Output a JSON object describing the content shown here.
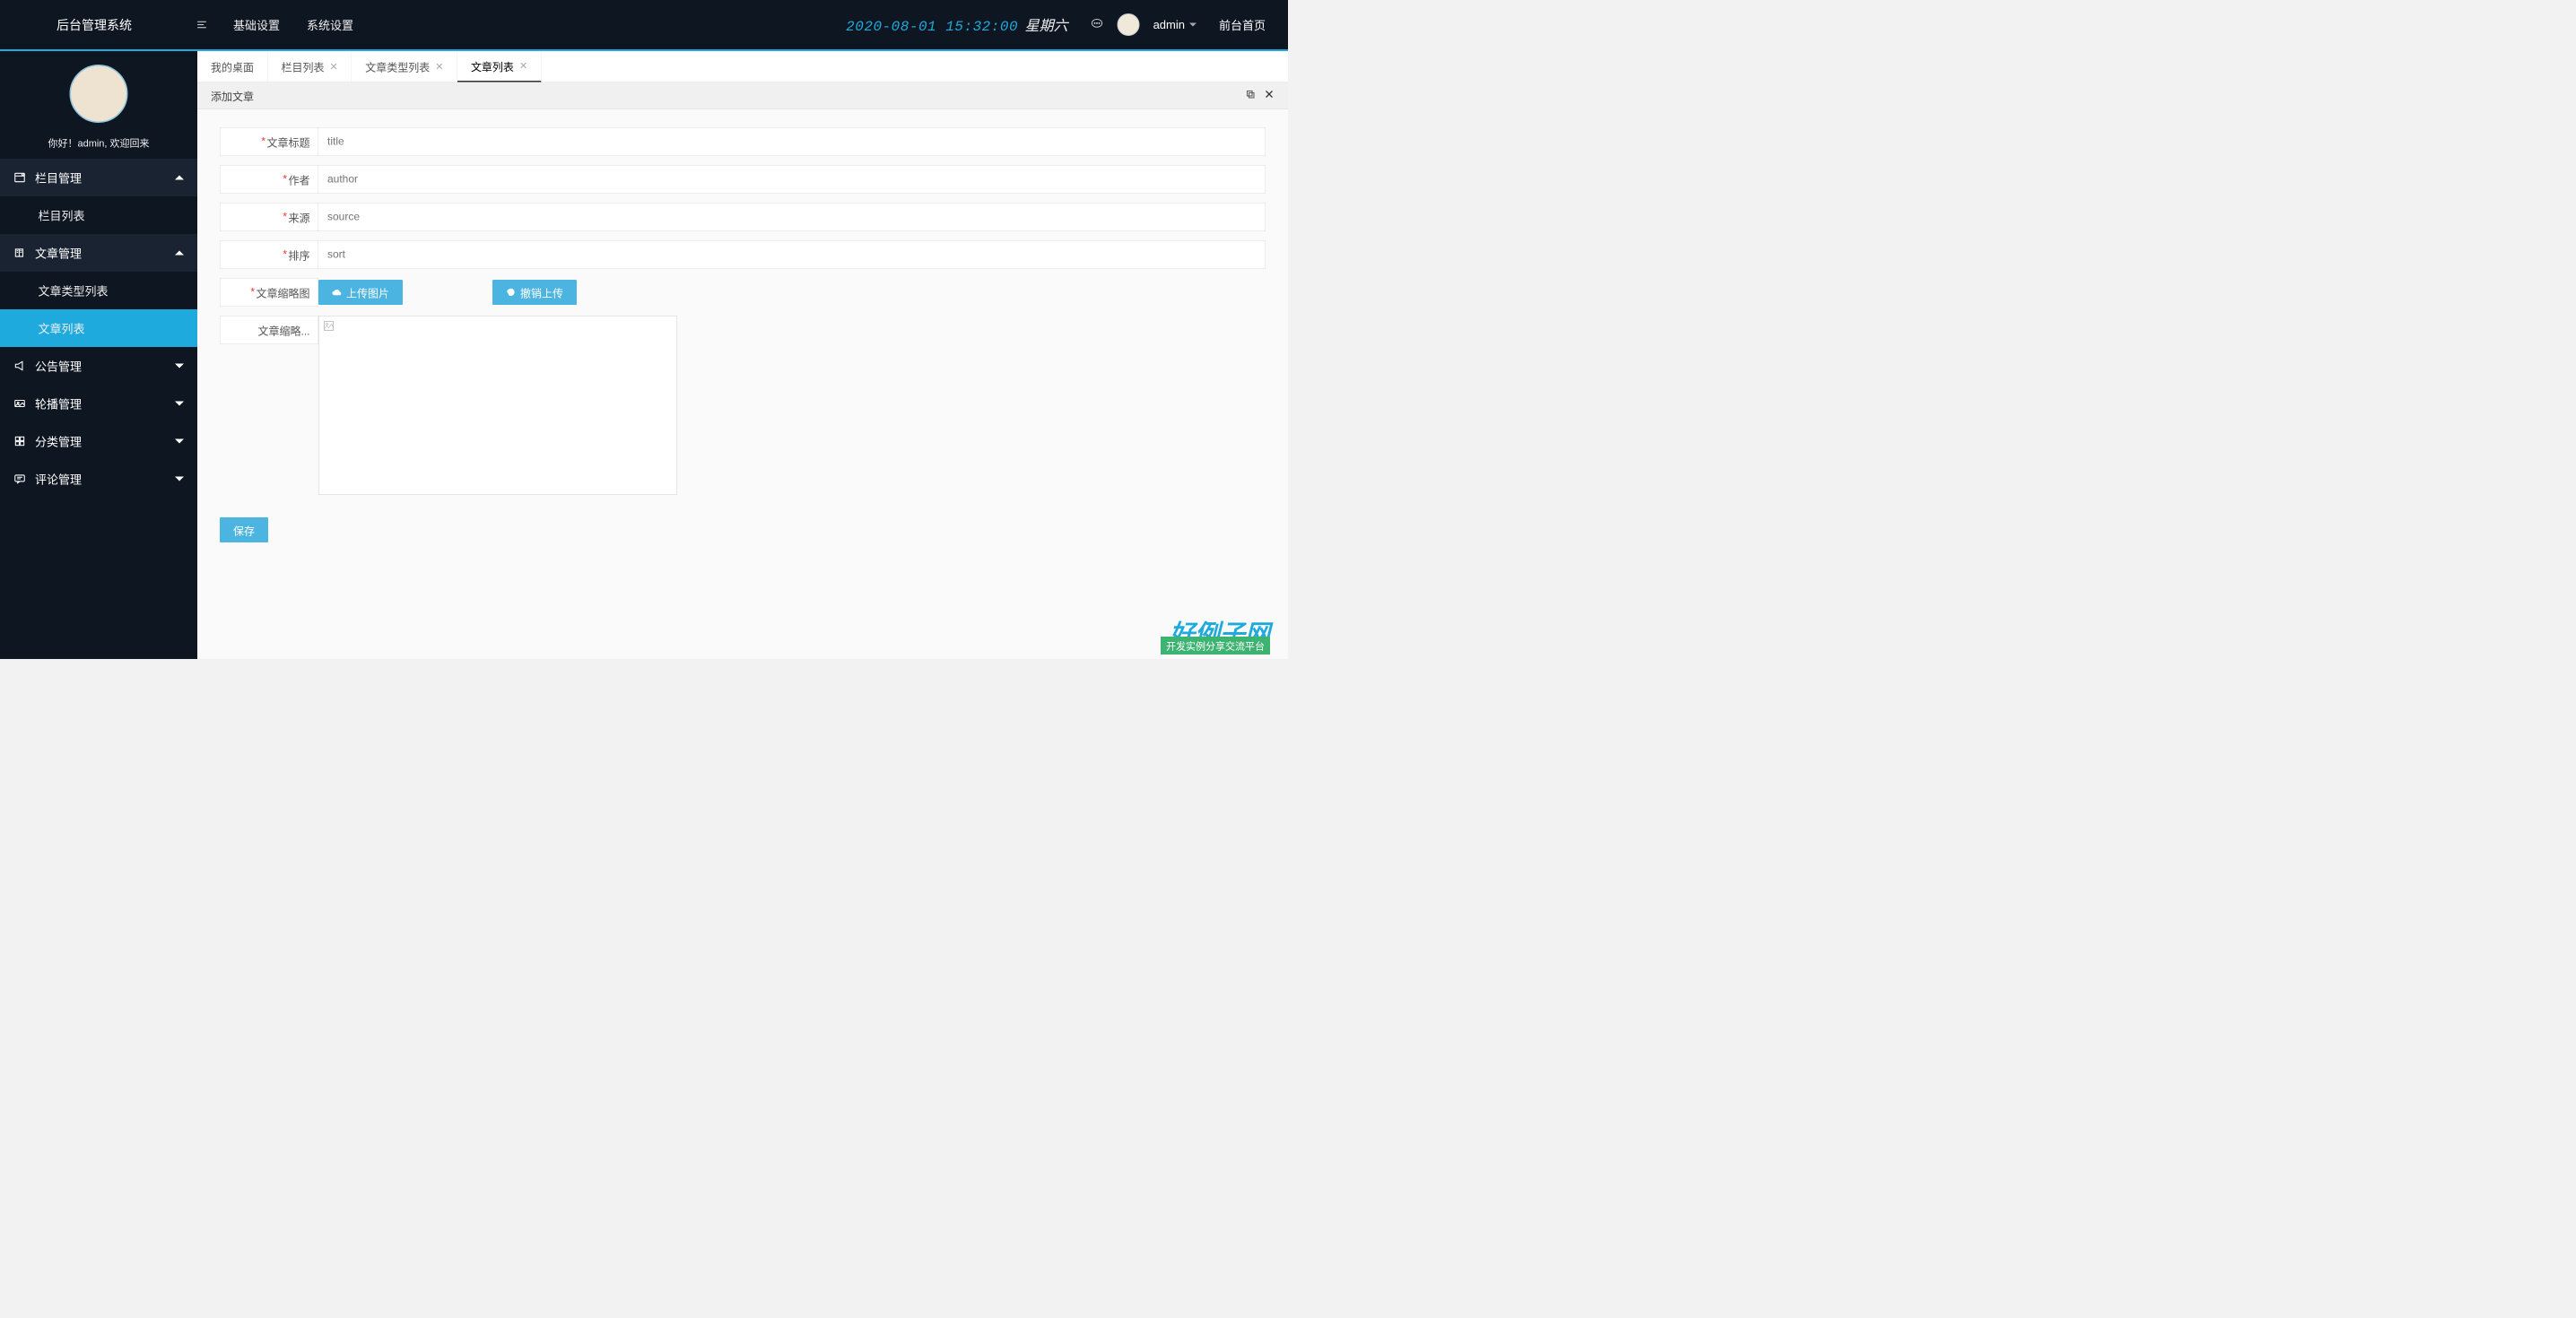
{
  "header": {
    "logo": "后台管理系统",
    "topMenu": [
      "基础设置",
      "系统设置"
    ],
    "datetime": "2020-08-01 15:32:00",
    "weekday": "星期六",
    "user": "admin",
    "frontLink": "前台首页"
  },
  "sidebar": {
    "welcome": "你好！admin, 欢迎回来",
    "groups": [
      {
        "label": "栏目管理",
        "expanded": true,
        "items": [
          "栏目列表"
        ]
      },
      {
        "label": "文章管理",
        "expanded": true,
        "items": [
          "文章类型列表",
          "文章列表"
        ]
      },
      {
        "label": "公告管理",
        "expanded": false
      },
      {
        "label": "轮播管理",
        "expanded": false
      },
      {
        "label": "分类管理",
        "expanded": false
      },
      {
        "label": "评论管理",
        "expanded": false
      }
    ],
    "activeItem": "文章列表"
  },
  "tabs": [
    {
      "label": "我的桌面",
      "closable": false
    },
    {
      "label": "栏目列表",
      "closable": true
    },
    {
      "label": "文章类型列表",
      "closable": true
    },
    {
      "label": "文章列表",
      "closable": true,
      "active": true
    }
  ],
  "panel": {
    "title": "添加文章",
    "form": {
      "title_label": "文章标题",
      "title_ph": "title",
      "author_label": "作者",
      "author_ph": "author",
      "source_label": "来源",
      "source_ph": "source",
      "sort_label": "排序",
      "sort_ph": "sort",
      "thumb_label": "文章缩略图",
      "upload_btn": "上传图片",
      "revoke_btn": "撤销上传",
      "preview_label": "文章缩略...",
      "save_btn": "保存"
    }
  },
  "watermark": {
    "title": "好例子网",
    "sub": "开发实例分享交流平台"
  }
}
